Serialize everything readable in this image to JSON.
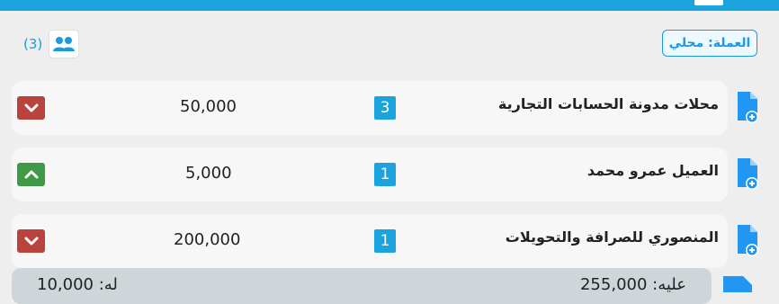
{
  "header": {
    "currency_label": "العملة: محلي",
    "user_count": "(3)"
  },
  "accounts": [
    {
      "name": "محلات مدونة الحسابات التجارية",
      "badge": "3",
      "amount": "50,000",
      "direction": "down"
    },
    {
      "name": "العميل عمرو محمد",
      "badge": "1",
      "amount": "5,000",
      "direction": "up"
    },
    {
      "name": "المنصوري للصرافة والتحويلات",
      "badge": "1",
      "amount": "200,000",
      "direction": "down"
    }
  ],
  "footer": {
    "right_text": "عليه: 255,000",
    "left_text": "له: 10,000"
  },
  "icons": {
    "users": "users-icon",
    "add_file": "file-add-icon",
    "chevron_down": "chevron-down-icon",
    "chevron_up": "chevron-up-icon"
  },
  "colors": {
    "primary": "#1aa3dd",
    "down": "#b9433d",
    "up": "#3f9a48",
    "file_icon": "#2196f3"
  }
}
